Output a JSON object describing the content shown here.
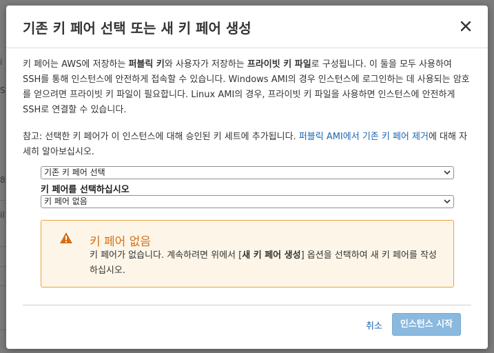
{
  "background": {
    "fragments": [
      "i",
      "S",
      "8",
      "il"
    ]
  },
  "modal": {
    "title": "기존 키 페어 선택 또는 새 키 페어 생성",
    "description": {
      "p1_a": "키 페어는 AWS에 저장하는 ",
      "p1_b": "퍼블릭 키",
      "p1_c": "와 사용자가 저장하는 ",
      "p1_d": "프라이빗 키 파일",
      "p1_e": "로 구성됩니다. 이 둘을 모두 사용하여 SSH를 통해 인스턴스에 안전하게 접속할 수 있습니다. Windows AMI의 경우 인스턴스에 로그인하는 데 사용되는 암호를 얻으려면 프라이빗 키 파일이 필요합니다. Linux AMI의 경우, 프라이빗 키 파일을 사용하면 인스턴스에 안전하게 SSH로 연결할 수 있습니다."
    },
    "note": {
      "text": "참고: 선택한 키 페어가 이 인스턴스에 대해 승인된 키 세트에 추가됩니다. ",
      "link": "퍼블릭 AMI에서 기존 키 페어 제거",
      "suffix": "에 대해 자세히 알아보십시오."
    },
    "select_option": "기존 키 페어 선택",
    "keypair_label": "키 페어를 선택하십시오",
    "keypair_value": "키 페어 없음",
    "alert": {
      "title": "키 페어 없음",
      "text_a": "키 페어가 없습니다. 계속하려면 위에서 [",
      "text_b": "새 키 페어 생성",
      "text_c": "] 옵션을 선택하여 새 키 페어를 작성하십시오."
    },
    "cancel_label": "취소",
    "launch_label": "인스턴스 시작"
  },
  "colors": {
    "accent_link": "#1a66b3",
    "warning": "#d56f16",
    "primary_button_disabled": "#8ab9df"
  }
}
